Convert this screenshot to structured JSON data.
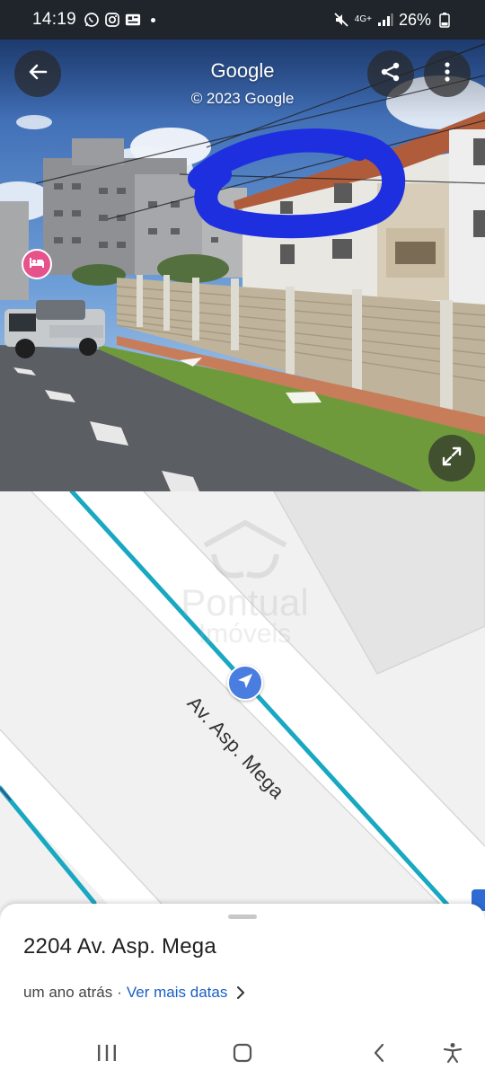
{
  "status_bar": {
    "time": "14:19",
    "network": "4G+",
    "battery": "26%"
  },
  "street_view": {
    "title": "Google",
    "copyright": "© 2023 Google",
    "icons": [
      "back-arrow-icon",
      "share-icon",
      "more-vert-icon",
      "expand-icon",
      "hotel-icon",
      "navigation-arrow-icon"
    ]
  },
  "map": {
    "street_label": "Av. Asp. Mega",
    "watermark": {
      "line1": "Pontual",
      "line2": "Imóveis"
    },
    "road_color": "#19a8c1"
  },
  "sheet": {
    "address": "2204 Av. Asp. Mega",
    "time_ago": "um ano atrás",
    "separator": "·",
    "more_dates_link": "Ver mais datas",
    "link_color": "#1a5fc4"
  },
  "nav": {
    "icons": [
      "recent-apps-icon",
      "home-icon",
      "back-icon",
      "accessibility-icon"
    ]
  }
}
